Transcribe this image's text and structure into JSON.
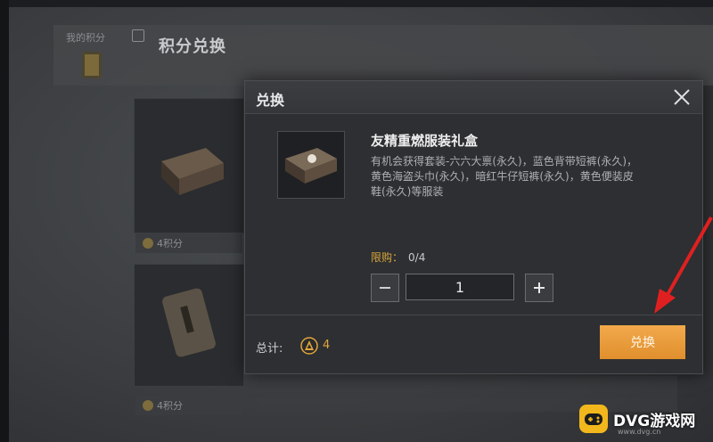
{
  "background": {
    "badge_label": "我的积分",
    "title": "积分兑换",
    "description": "",
    "cards": [
      {
        "price": "4积分"
      },
      {
        "price": "4积分"
      }
    ]
  },
  "modal": {
    "title": "兑换",
    "close_icon": "close-icon",
    "item": {
      "name": "友精重燃服装礼盒",
      "description": "有机会获得套装-六六大禀(永久)，蓝色背带短裤(永久)，黄色海盗头巾(永久)，暗红牛仔短裤(永久)，黄色便装皮鞋(永久)等服装",
      "limit_label": "限购：",
      "limit_value": "0/4"
    },
    "stepper": {
      "minus": "−",
      "quantity": "1",
      "plus": "+"
    },
    "total_label": "总计:",
    "total_value": "4",
    "exchange_button": "兑换"
  },
  "watermark": {
    "text": "DVG游戏网",
    "url": "www.dvg.cn"
  },
  "colors": {
    "accent_orange": "#e99a36",
    "limit_gold": "#d9a53a",
    "arrow_red": "#e02020"
  }
}
